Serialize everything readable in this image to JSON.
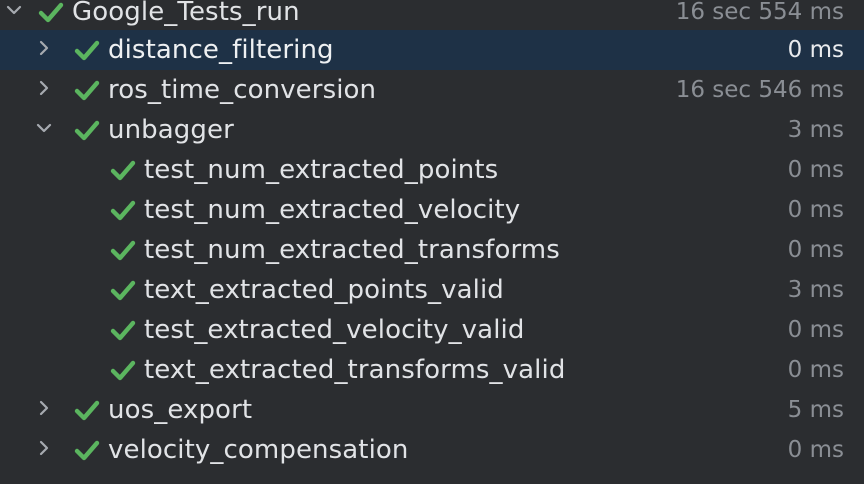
{
  "colors": {
    "background": "#2b2d30",
    "selected_row": "#1e3146",
    "pass_green": "#5bb55f",
    "label": "#e1e3e6",
    "time": "#8a8e94"
  },
  "rows": [
    {
      "label": "Google_Tests_run",
      "time": "16 sec 554 ms",
      "icon": "check-icon",
      "expander": "chevron-down-icon"
    },
    {
      "label": "distance_filtering",
      "time": "0 ms",
      "icon": "check-icon",
      "expander": "chevron-right-icon",
      "selected": true
    },
    {
      "label": "ros_time_conversion",
      "time": "16 sec 546 ms",
      "icon": "check-icon",
      "expander": "chevron-right-icon"
    },
    {
      "label": "unbagger",
      "time": "3 ms",
      "icon": "check-icon",
      "expander": "chevron-down-icon"
    },
    {
      "label": "test_num_extracted_points",
      "time": "0 ms",
      "icon": "check-icon"
    },
    {
      "label": "test_num_extracted_velocity",
      "time": "0 ms",
      "icon": "check-icon"
    },
    {
      "label": "test_num_extracted_transforms",
      "time": "0 ms",
      "icon": "check-icon"
    },
    {
      "label": "text_extracted_points_valid",
      "time": "3 ms",
      "icon": "check-icon"
    },
    {
      "label": "test_extracted_velocity_valid",
      "time": "0 ms",
      "icon": "check-icon"
    },
    {
      "label": "text_extracted_transforms_valid",
      "time": "0 ms",
      "icon": "check-icon"
    },
    {
      "label": "uos_export",
      "time": "5 ms",
      "icon": "check-icon",
      "expander": "chevron-right-icon"
    },
    {
      "label": "velocity_compensation",
      "time": "0 ms",
      "icon": "check-icon",
      "expander": "chevron-right-icon"
    }
  ]
}
